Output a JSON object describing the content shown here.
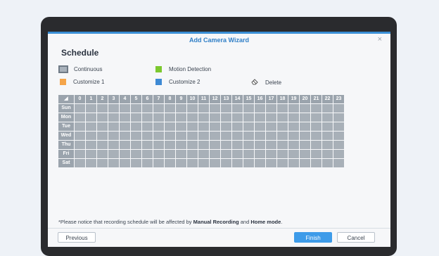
{
  "wizard": {
    "title": "Add Camera Wizard",
    "close_glyph": "×"
  },
  "schedule": {
    "heading": "Schedule",
    "legend": {
      "continuous": {
        "label": "Continuous",
        "color": "#a8b1bb"
      },
      "motion": {
        "label": "Motion Detection",
        "color": "#7cc82f"
      },
      "customize1": {
        "label": "Customize 1",
        "color": "#f5a54a"
      },
      "customize2": {
        "label": "Customize 2",
        "color": "#3e8ad4"
      },
      "delete": {
        "label": "Delete",
        "icon": "eraser-icon"
      }
    },
    "corner_glyph": "◢",
    "hours": [
      "0",
      "1",
      "2",
      "3",
      "4",
      "5",
      "6",
      "7",
      "8",
      "9",
      "10",
      "11",
      "12",
      "13",
      "14",
      "15",
      "16",
      "17",
      "18",
      "19",
      "20",
      "21",
      "22",
      "23"
    ],
    "days": [
      "Sun",
      "Mon",
      "Tue",
      "Wed",
      "Thu",
      "Fri",
      "Sat"
    ]
  },
  "notice": {
    "prefix": "*Please notice that recording schedule will be affected by ",
    "bold1": "Manual Recording",
    "middle": " and ",
    "bold2": "Home mode",
    "suffix": "."
  },
  "buttons": {
    "previous": "Previous",
    "finish": "Finish",
    "cancel": "Cancel"
  }
}
